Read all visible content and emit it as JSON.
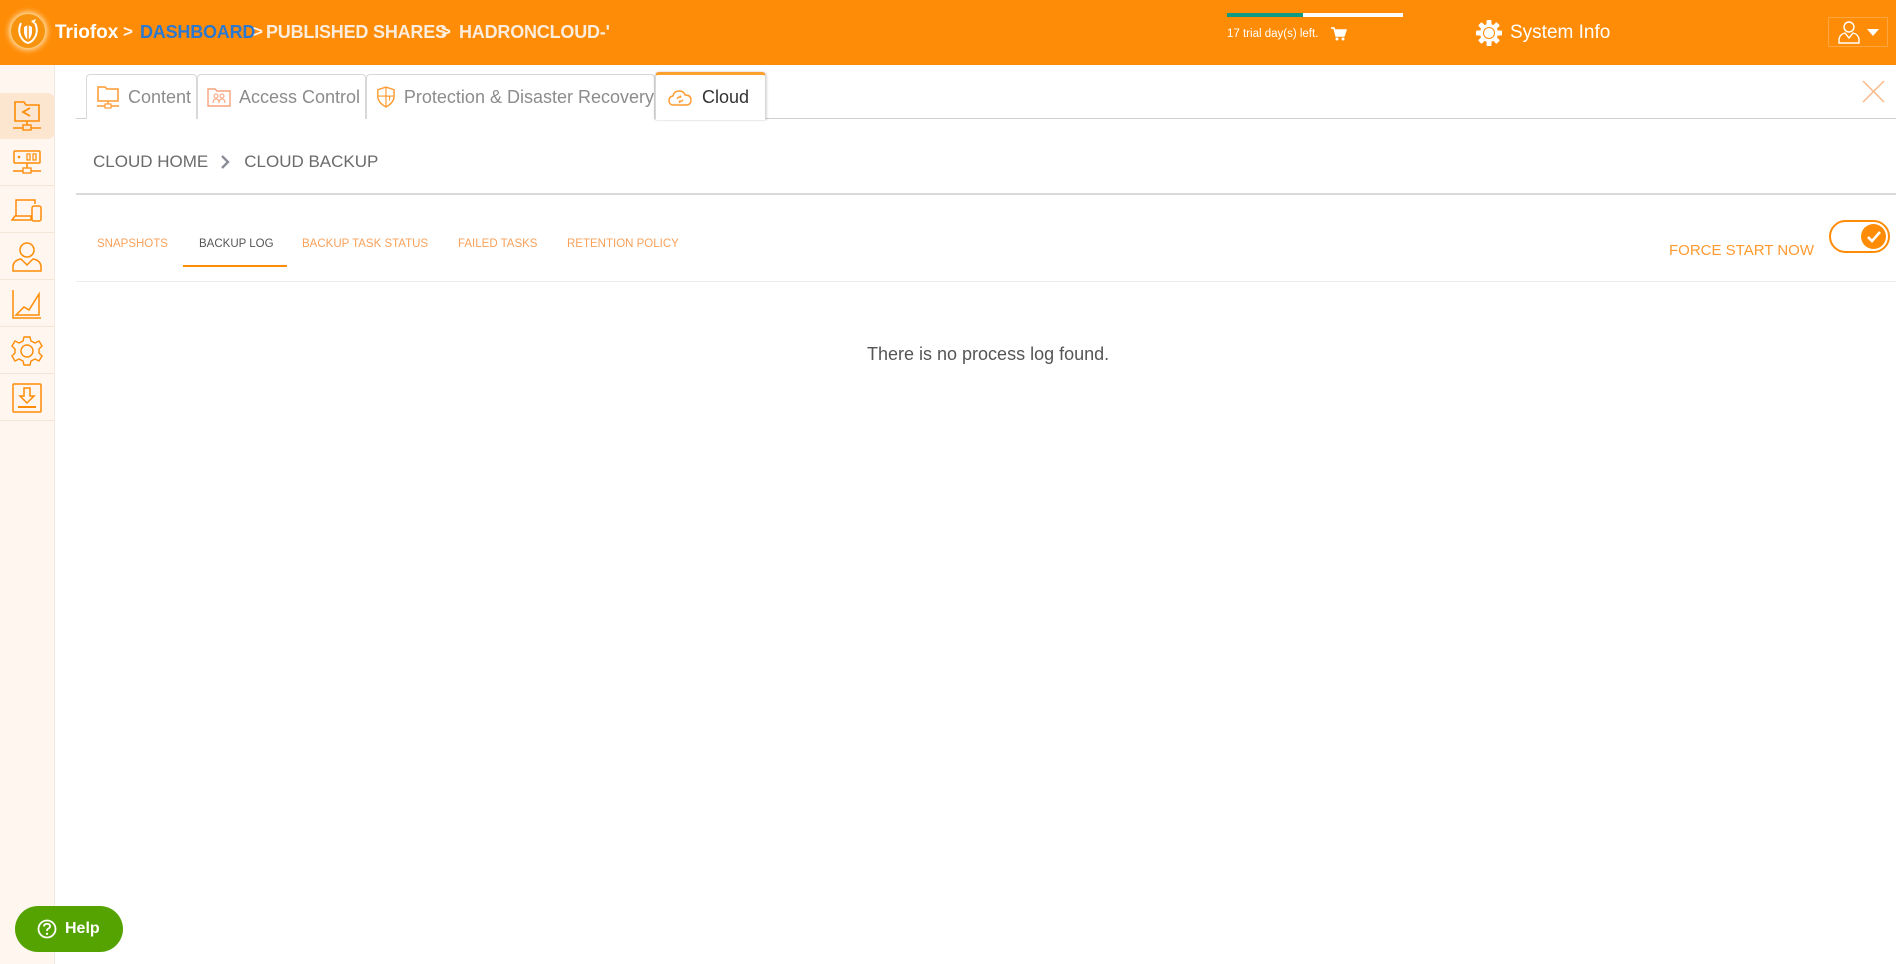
{
  "header": {
    "app_name": "Triofox",
    "breadcrumb": [
      {
        "label": "DASHBOARD",
        "link": true
      },
      {
        "label": "PUBLISHED SHARES",
        "link": false
      },
      {
        "label": "HADRONCLOUD-'",
        "link": false
      }
    ],
    "separator": ">",
    "trial": {
      "text": "17 trial day(s) left.",
      "progress_fraction": 0.43,
      "progress_color": "#0e9a83"
    },
    "system_info_label": "System Info",
    "brand_color": "#ff8c06"
  },
  "sidebar": {
    "items": [
      {
        "icon": "shared-folder-icon",
        "active": true
      },
      {
        "icon": "storage-server-icon",
        "active": false
      },
      {
        "icon": "devices-icon",
        "active": false
      },
      {
        "icon": "user-icon",
        "active": false
      },
      {
        "icon": "chart-icon",
        "active": false
      },
      {
        "icon": "settings-gear-icon",
        "active": false
      },
      {
        "icon": "download-icon",
        "active": false
      }
    ]
  },
  "main_tabs": [
    {
      "label": "Content",
      "icon": "content-folder-icon",
      "active": false
    },
    {
      "label": "Access Control",
      "icon": "access-control-icon",
      "active": false
    },
    {
      "label": "Protection & Disaster Recovery",
      "icon": "shield-icon",
      "active": false
    },
    {
      "label": "Cloud",
      "icon": "cloud-sync-icon",
      "active": true
    }
  ],
  "breadcrumb": {
    "home": "CLOUD HOME",
    "current": "CLOUD BACKUP"
  },
  "sub_tabs": [
    {
      "label": "SNAPSHOTS",
      "active": false
    },
    {
      "label": "BACKUP LOG",
      "active": true
    },
    {
      "label": "BACKUP TASK STATUS",
      "active": false
    },
    {
      "label": "FAILED TASKS",
      "active": false
    },
    {
      "label": "RETENTION POLICY",
      "active": false
    }
  ],
  "force_start": {
    "label": "FORCE START NOW",
    "toggle_on": true
  },
  "content": {
    "empty_message": "There is no process log found."
  },
  "help": {
    "label": "Help"
  }
}
